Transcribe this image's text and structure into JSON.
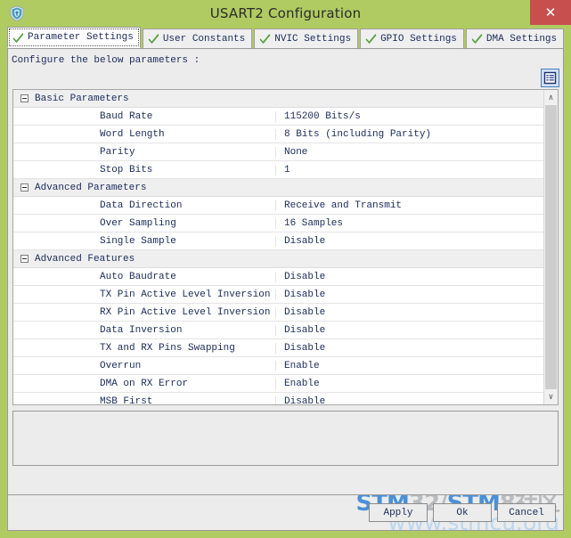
{
  "window": {
    "title": "USART2 Configuration",
    "app_icon": "shield-icon",
    "close_label": "✕",
    "chrome_color": "#b0cb62",
    "close_color": "#c7504f"
  },
  "tabs": [
    {
      "label": "Parameter Settings",
      "icon": "green-check-icon",
      "active": true
    },
    {
      "label": "User Constants",
      "icon": "green-check-icon",
      "active": false
    },
    {
      "label": "NVIC Settings",
      "icon": "green-check-icon",
      "active": false
    },
    {
      "label": "GPIO Settings",
      "icon": "green-check-icon",
      "active": false
    },
    {
      "label": "DMA Settings",
      "icon": "green-check-icon",
      "active": false
    }
  ],
  "content": {
    "hint": "Configure the below parameters :",
    "toolbar": {
      "view_button_icon": "list-view-icon"
    },
    "groups": [
      {
        "title": "Basic Parameters",
        "expanded": true,
        "rows": [
          {
            "name": "Baud Rate",
            "value": "115200 Bits/s"
          },
          {
            "name": "Word Length",
            "value": "8 Bits (including Parity)"
          },
          {
            "name": "Parity",
            "value": "None"
          },
          {
            "name": "Stop Bits",
            "value": "1"
          }
        ]
      },
      {
        "title": "Advanced Parameters",
        "expanded": true,
        "rows": [
          {
            "name": "Data Direction",
            "value": "Receive and Transmit"
          },
          {
            "name": "Over Sampling",
            "value": "16 Samples"
          },
          {
            "name": "Single Sample",
            "value": "Disable"
          }
        ]
      },
      {
        "title": "Advanced Features",
        "expanded": true,
        "rows": [
          {
            "name": "Auto Baudrate",
            "value": "Disable"
          },
          {
            "name": "TX Pin Active Level Inversion",
            "value": "Disable"
          },
          {
            "name": "RX Pin Active Level Inversion",
            "value": "Disable"
          },
          {
            "name": "Data Inversion",
            "value": "Disable"
          },
          {
            "name": "TX and RX Pins Swapping",
            "value": "Disable"
          },
          {
            "name": "Overrun",
            "value": "Enable"
          },
          {
            "name": "DMA on RX Error",
            "value": "Enable"
          },
          {
            "name": "MSB First",
            "value": "Disable"
          }
        ]
      }
    ],
    "scrollbar": {
      "up_arrow": "∧",
      "down_arrow": "∨"
    },
    "description": ""
  },
  "footer": {
    "apply_label": "Apply",
    "ok_label": "Ok",
    "cancel_label": "Cancel"
  },
  "watermark": {
    "part1": "STM",
    "part2": "32/",
    "part3": "STM",
    "part4": "8社区",
    "line2": "www.stmcu.org",
    "blue": "#4a90d9",
    "gray": "#b8bcbf"
  }
}
